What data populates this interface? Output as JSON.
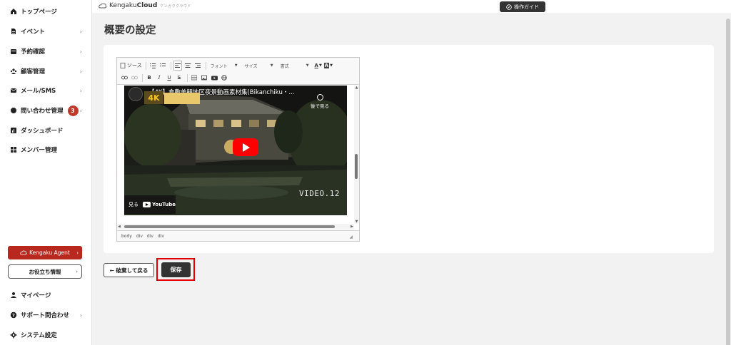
{
  "sidebar": {
    "items": [
      {
        "label": "トップページ",
        "icon": "home-icon",
        "has_chevron": false
      },
      {
        "label": "イベント",
        "icon": "document-icon",
        "has_chevron": true
      },
      {
        "label": "予約確認",
        "icon": "calendar-icon",
        "has_chevron": true
      },
      {
        "label": "顧客管理",
        "icon": "users-icon",
        "has_chevron": true
      },
      {
        "label": "メール/SMS",
        "icon": "mail-icon",
        "has_chevron": true
      },
      {
        "label": "問い合わせ管理",
        "icon": "chat-icon",
        "has_chevron": true,
        "badge": "3"
      },
      {
        "label": "ダッシュボード",
        "icon": "chart-icon",
        "has_chevron": false
      },
      {
        "label": "メンバー管理",
        "icon": "grid-icon",
        "has_chevron": false
      }
    ],
    "agent_button": {
      "label": "Kengaku Agent"
    },
    "info_button": {
      "label": "お役立ち情報"
    },
    "bottom_items": [
      {
        "label": "マイページ",
        "icon": "user-icon",
        "has_chevron": false
      },
      {
        "label": "サポート問合わせ",
        "icon": "help-icon",
        "has_chevron": true
      },
      {
        "label": "システム設定",
        "icon": "gear-icon",
        "has_chevron": false
      }
    ]
  },
  "topbar": {
    "logo_text": "Kengaku",
    "logo_bold": "Cloud",
    "logo_tagline": "ケンガククラウド",
    "guide_button": "操作ガイド"
  },
  "page": {
    "title": "概要の設定"
  },
  "editor": {
    "toolbar_row1": {
      "source": "ソース",
      "font": "フォント",
      "size": "サイズ",
      "format": "書式"
    },
    "toolbar_row2": {
      "bold": "B",
      "italic": "I",
      "underline": "U",
      "strike": "S"
    },
    "video": {
      "title": "【4K】倉敷美観地区夜景動画素材集(Bikanchiku・...",
      "badge_4k": "4K",
      "watch_later": "後で見る",
      "watermark": "VIDEO.12",
      "watch_on": "見る",
      "youtube": "YouTube"
    },
    "statusbar": [
      "body",
      "div",
      "div",
      "div"
    ]
  },
  "actions": {
    "back": "← 破棄して戻る",
    "save": "保存"
  },
  "colors": {
    "accent_red": "#b8281e",
    "badge_red": "#c0392b",
    "dark_button": "#333333",
    "highlight": "#e00000"
  }
}
